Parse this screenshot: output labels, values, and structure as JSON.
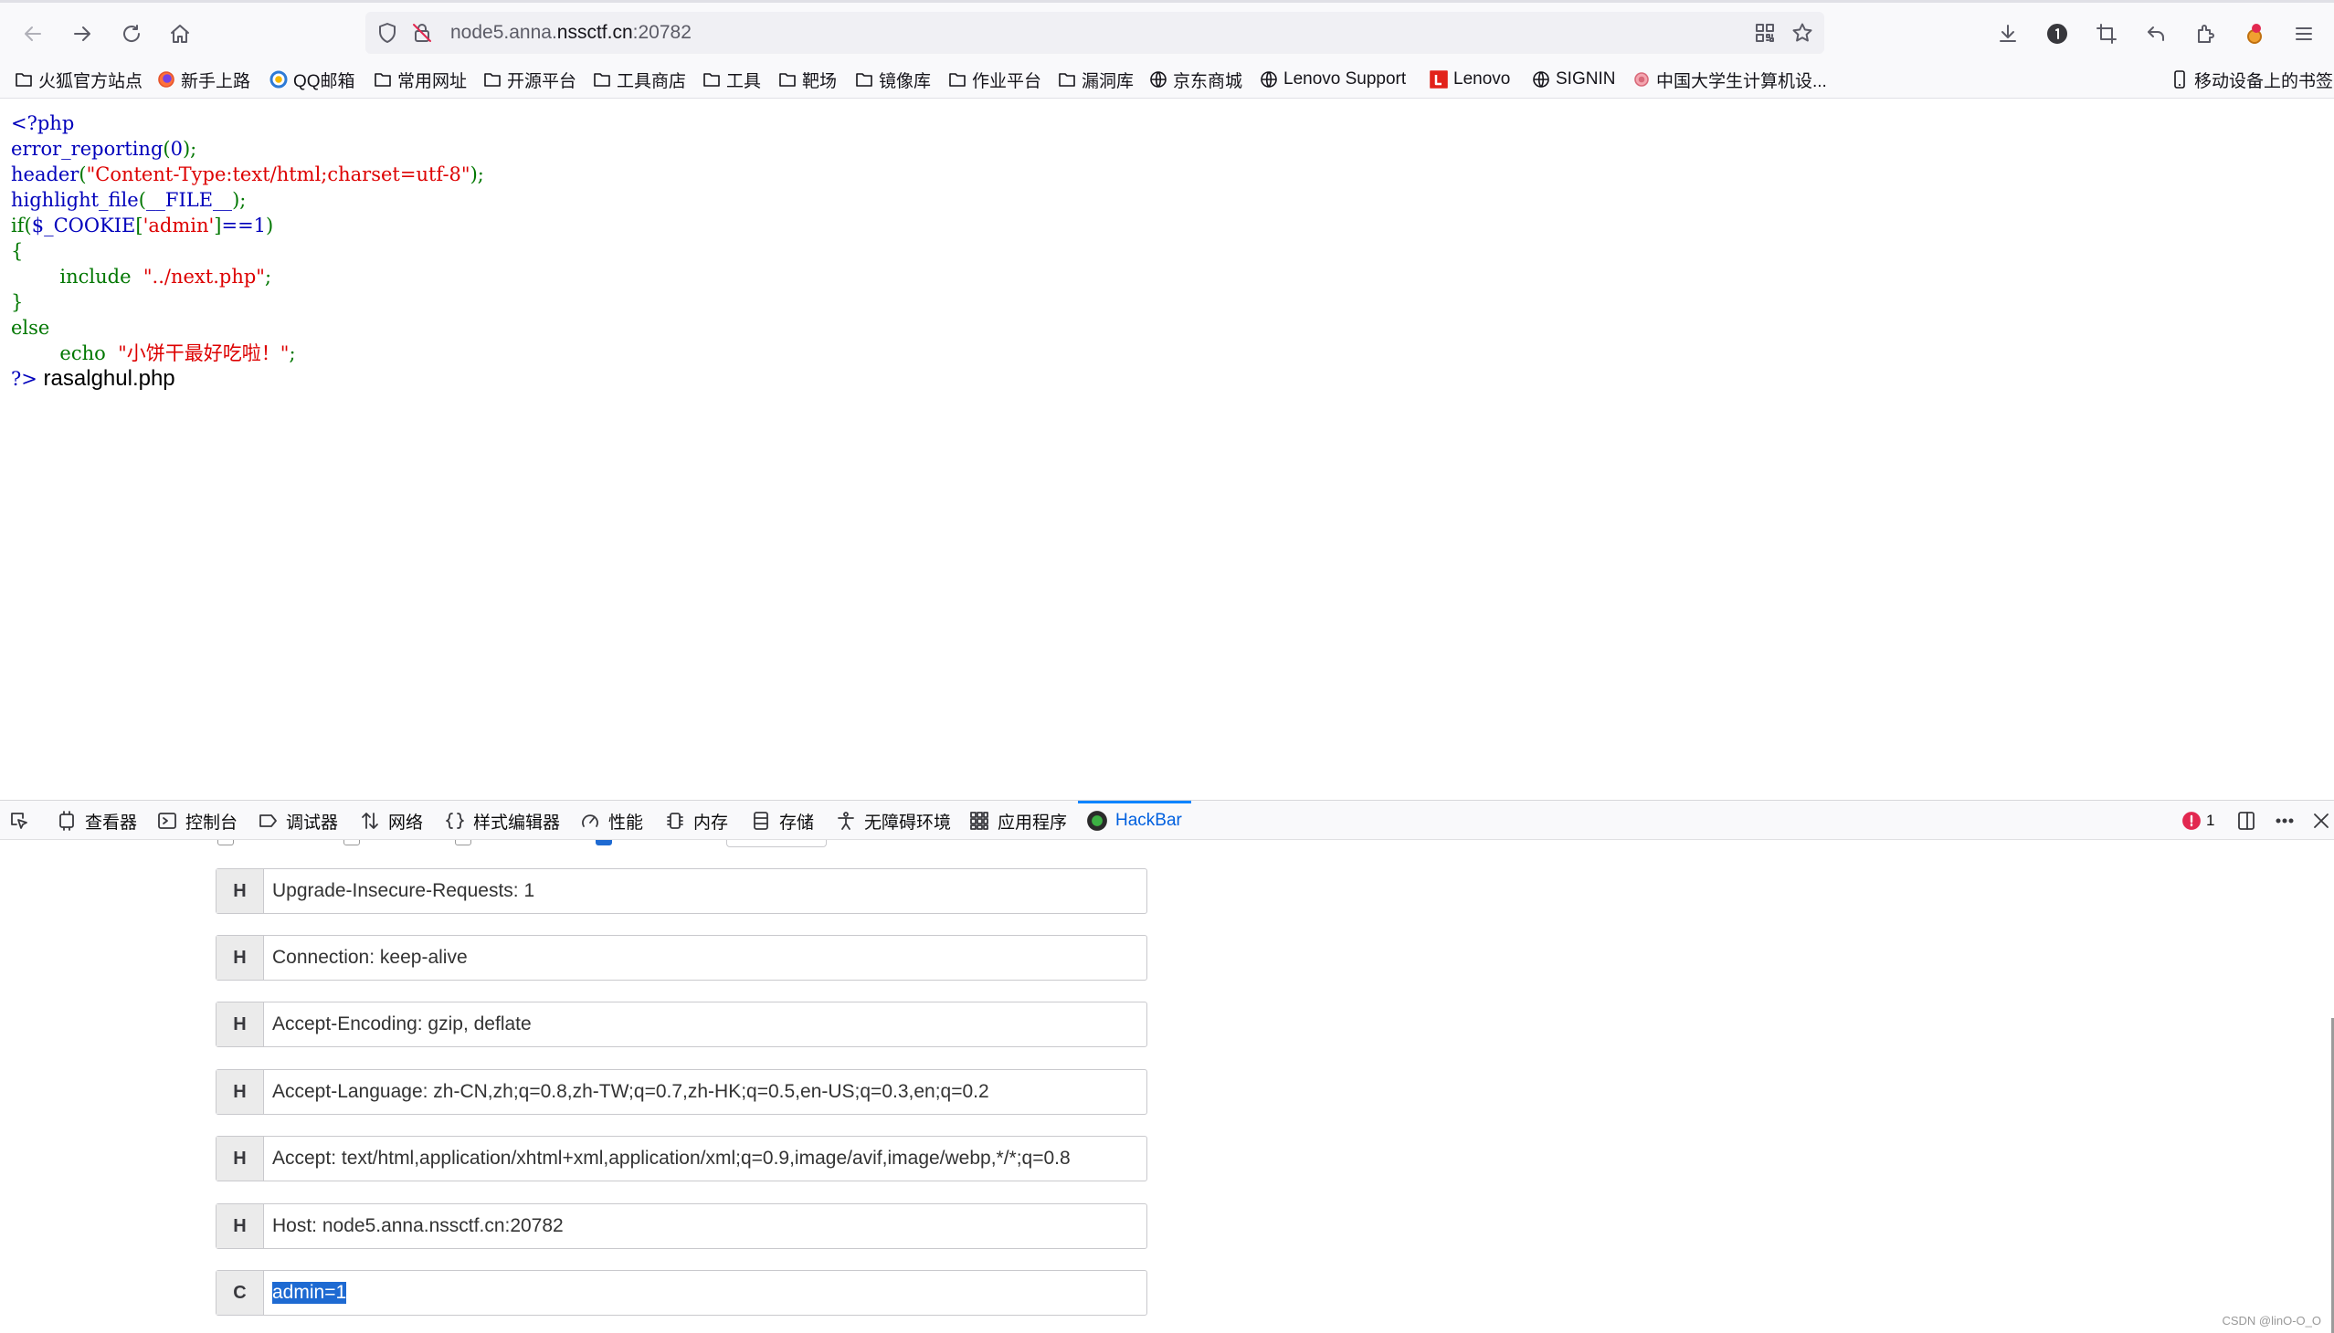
{
  "browser": {
    "url_prefix": "node5.anna.",
    "url_domain": "nssctf.cn",
    "url_port": ":20782"
  },
  "bookmarks": [
    {
      "label": "火狐官方站点",
      "icon": "folder-icon"
    },
    {
      "label": "新手上路",
      "icon": "firefox-icon"
    },
    {
      "label": "QQ邮箱",
      "icon": "qqmail-icon"
    },
    {
      "label": "常用网址",
      "icon": "folder-icon"
    },
    {
      "label": "开源平台",
      "icon": "folder-icon"
    },
    {
      "label": "工具商店",
      "icon": "folder-icon"
    },
    {
      "label": "工具",
      "icon": "folder-icon"
    },
    {
      "label": "靶场",
      "icon": "folder-icon"
    },
    {
      "label": "镜像库",
      "icon": "folder-icon"
    },
    {
      "label": "作业平台",
      "icon": "folder-icon"
    },
    {
      "label": "漏洞库",
      "icon": "folder-icon"
    },
    {
      "label": "京东商城",
      "icon": "globe-icon"
    },
    {
      "label": "Lenovo Support",
      "icon": "globe-icon"
    },
    {
      "label": "Lenovo",
      "icon": "lenovo-icon"
    },
    {
      "label": "SIGNIN",
      "icon": "globe-icon"
    },
    {
      "label": "中国大学生计算机设...",
      "icon": "flower-icon"
    },
    {
      "label": "移动设备上的书签",
      "icon": "mobile-icon"
    }
  ],
  "code": {
    "l1": "<?php",
    "l2_fn": "error_reporting",
    "l2_arg": "0",
    "l3_fn": "header",
    "l3_arg": "\"Content-Type:text/html;charset=utf-8\"",
    "l4_fn": "highlight_file",
    "l4_arg": "__FILE__",
    "l5_if": "if",
    "l5_var": "$_COOKIE",
    "l5_key": "'admin'",
    "l5_cmp": "==1",
    "l6": "{",
    "l7_kw": "include",
    "l7_str": "\"../next.php\"",
    "l8": "}",
    "l9": "else",
    "l10_kw": "echo",
    "l10_str": "\"小饼干最好吃啦！\"",
    "l11": "?>",
    "output": "rasalghul.php"
  },
  "devtools": {
    "tabs": [
      "查看器",
      "控制台",
      "调试器",
      "网络",
      "样式编辑器",
      "性能",
      "内存",
      "存储",
      "无障碍环境",
      "应用程序",
      "HackBar"
    ],
    "error_count": "1"
  },
  "hackbar": {
    "rows": [
      {
        "tag": "H",
        "value": "Upgrade-Insecure-Requests: 1"
      },
      {
        "tag": "H",
        "value": "Connection: keep-alive"
      },
      {
        "tag": "H",
        "value": "Accept-Encoding: gzip, deflate"
      },
      {
        "tag": "H",
        "value": "Accept-Language: zh-CN,zh;q=0.8,zh-TW;q=0.7,zh-HK;q=0.5,en-US;q=0.3,en;q=0.2"
      },
      {
        "tag": "H",
        "value": "Accept: text/html,application/xhtml+xml,application/xml;q=0.9,image/avif,image/webp,*/*;q=0.8"
      },
      {
        "tag": "H",
        "value": "Host: node5.anna.nssctf.cn:20782"
      },
      {
        "tag": "C",
        "value": "admin=1"
      }
    ]
  },
  "watermark": "CSDN @linO-O_O"
}
